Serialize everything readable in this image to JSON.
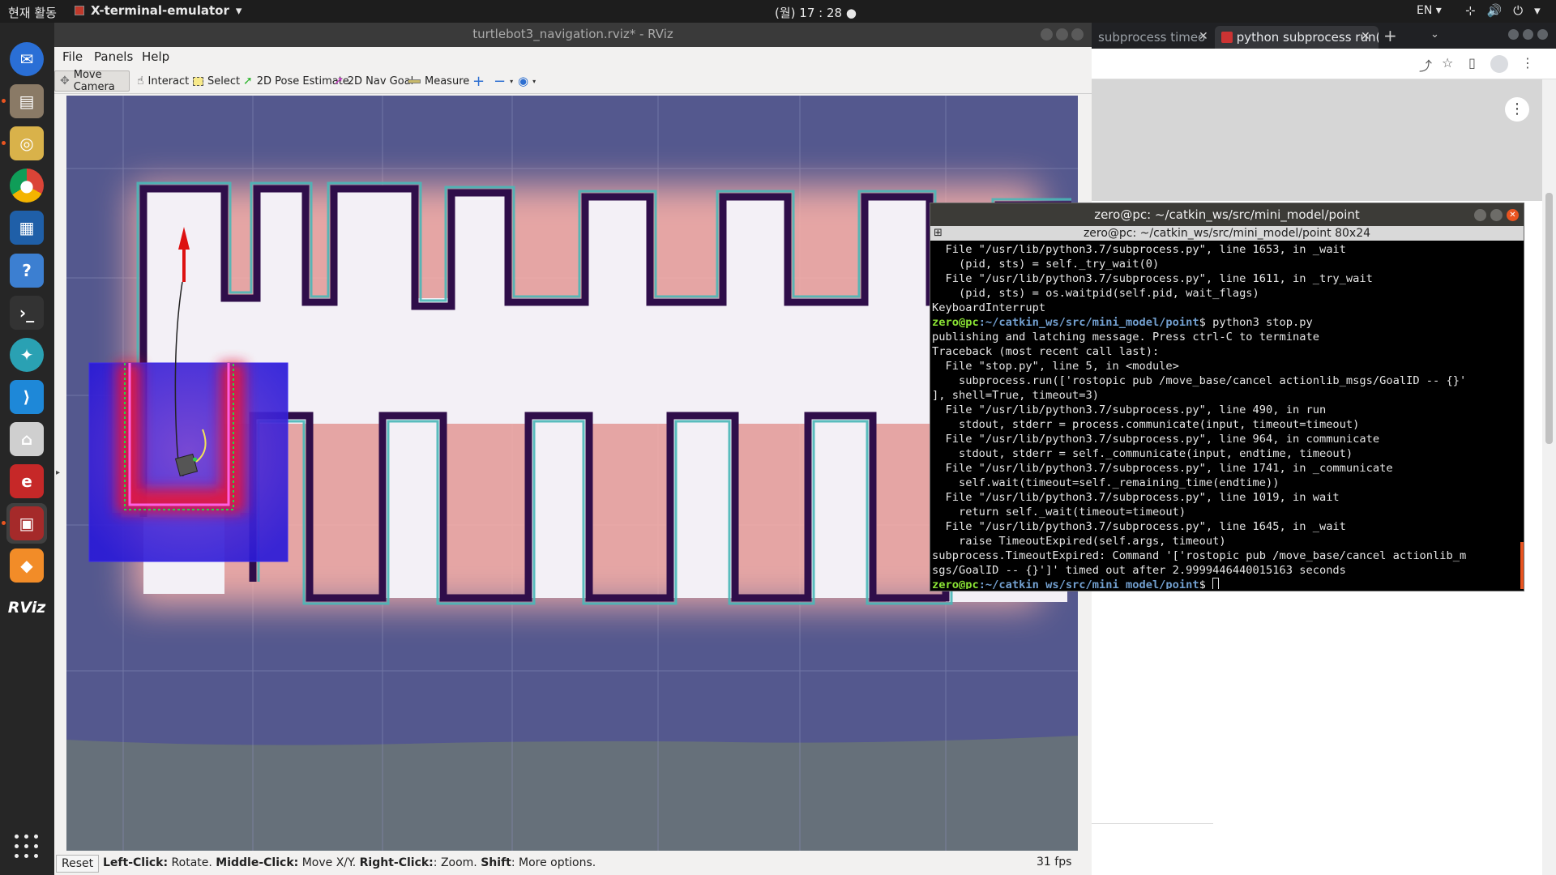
{
  "topbar": {
    "activities": "현재 활동",
    "app_name": "X-terminal-emulator",
    "clock": "(월) 17 : 28",
    "lang": "EN"
  },
  "dock": {
    "items": [
      {
        "name": "thunderbird-icon",
        "color": "#2a6fd6"
      },
      {
        "name": "files-icon",
        "color": "#8a7a66"
      },
      {
        "name": "rhythmbox-icon",
        "color": "#d9b24a"
      },
      {
        "name": "chrome-icon",
        "color": "#db4437"
      },
      {
        "name": "writer-icon",
        "color": "#1f5fa8"
      },
      {
        "name": "help-icon",
        "color": "#3c7fd1"
      },
      {
        "name": "terminal-icon",
        "color": "#333333"
      },
      {
        "name": "app-icon",
        "color": "#2aa1b3"
      },
      {
        "name": "vscode-icon",
        "color": "#1e88d8"
      },
      {
        "name": "software-icon",
        "color": "#cfcfcf"
      },
      {
        "name": "app2-icon",
        "color": "#c62828"
      },
      {
        "name": "terminal-active-icon",
        "color": "#a52a2a"
      },
      {
        "name": "sublime-icon",
        "color": "#f28c28"
      },
      {
        "name": "rviz-icon",
        "color": "#262626"
      }
    ],
    "rviz_label": "RViz"
  },
  "rviz": {
    "title": "turtlebot3_navigation.rviz* - RViz",
    "menu": [
      "File",
      "Panels",
      "Help"
    ],
    "tools": [
      {
        "label": "Move Camera",
        "icon": "move-camera-icon"
      },
      {
        "label": "Interact",
        "icon": "hand-icon"
      },
      {
        "label": "Select",
        "icon": "select-icon"
      },
      {
        "label": "2D Pose Estimate",
        "icon": "pose-estimate-icon"
      },
      {
        "label": "2D Nav Goal",
        "icon": "nav-goal-icon"
      },
      {
        "label": "Measure",
        "icon": "measure-icon"
      }
    ],
    "status": {
      "reset": "Reset",
      "b1": "Left-Click:",
      "t1": " Rotate. ",
      "b2": "Middle-Click:",
      "t2": " Move X/Y. ",
      "b3": "Right-Click:",
      "t3": ": Zoom. ",
      "b4": "Shift",
      "t4": ": More options.",
      "fps": "31 fps"
    }
  },
  "browser": {
    "tab1": "subprocess timeo",
    "tab2": "python subprocess run()"
  },
  "terminal": {
    "title": "zero@pc: ~/catkin_ws/src/mini_model/point",
    "subtitle": "zero@pc: ~/catkin_ws/src/mini_model/point 80x24",
    "lines": [
      {
        "t": "  File \"/usr/lib/python3.7/subprocess.py\", line 1653, in _wait"
      },
      {
        "t": "    (pid, sts) = self._try_wait(0)"
      },
      {
        "t": "  File \"/usr/lib/python3.7/subprocess.py\", line 1611, in _try_wait"
      },
      {
        "t": "    (pid, sts) = os.waitpid(self.pid, wait_flags)"
      },
      {
        "t": "KeyboardInterrupt"
      },
      {
        "p": "zero@pc",
        "d": ":~/catkin_ws/src/mini_model/point",
        "t": "$ python3 stop.py"
      },
      {
        "t": "publishing and latching message. Press ctrl-C to terminate"
      },
      {
        "t": "Traceback (most recent call last):"
      },
      {
        "t": "  File \"stop.py\", line 5, in <module>"
      },
      {
        "t": "    subprocess.run(['rostopic pub /move_base/cancel actionlib_msgs/GoalID -- {}'"
      },
      {
        "t": "], shell=True, timeout=3)"
      },
      {
        "t": "  File \"/usr/lib/python3.7/subprocess.py\", line 490, in run"
      },
      {
        "t": "    stdout, stderr = process.communicate(input, timeout=timeout)"
      },
      {
        "t": "  File \"/usr/lib/python3.7/subprocess.py\", line 964, in communicate"
      },
      {
        "t": "    stdout, stderr = self._communicate(input, endtime, timeout)"
      },
      {
        "t": "  File \"/usr/lib/python3.7/subprocess.py\", line 1741, in _communicate"
      },
      {
        "t": "    self.wait(timeout=self._remaining_time(endtime))"
      },
      {
        "t": "  File \"/usr/lib/python3.7/subprocess.py\", line 1019, in wait"
      },
      {
        "t": "    return self._wait(timeout=timeout)"
      },
      {
        "t": "  File \"/usr/lib/python3.7/subprocess.py\", line 1645, in _wait"
      },
      {
        "t": "    raise TimeoutExpired(self.args, timeout)"
      },
      {
        "t": "subprocess.TimeoutExpired: Command '['rostopic pub /move_base/cancel actionlib_m"
      },
      {
        "t": "sgs/GoalID -- {}']' timed out after 2.9999446440015163 seconds"
      },
      {
        "p": "zero@pc",
        "d": ":~/catkin_ws/src/mini_model/point",
        "t": "$ ",
        "cursor": true
      }
    ]
  }
}
